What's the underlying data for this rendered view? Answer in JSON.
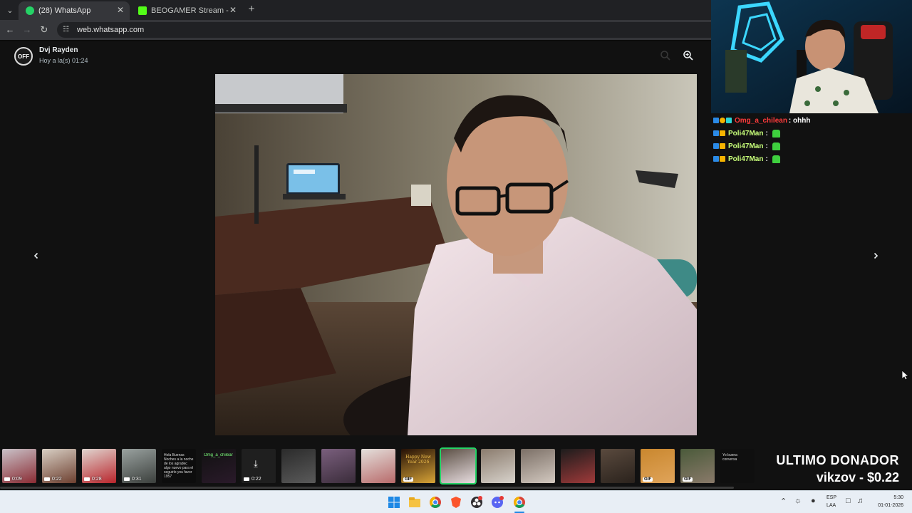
{
  "browser": {
    "tabs": [
      {
        "title": "(28) WhatsApp",
        "favicon": "whatsapp-icon",
        "color": "#25d366",
        "active": true
      },
      {
        "title": "BEOGAMER Stream - Watch Liv",
        "favicon": "kick-icon",
        "color": "#53fc18",
        "active": false
      }
    ],
    "url": "web.whatsapp.com"
  },
  "viewer": {
    "sender_name": "Dvj Rayden",
    "avatar_text": "OFF",
    "sent_time": "Hoy a la(s) 01:24",
    "thumbnails": [
      {
        "kind": "video",
        "duration": "0:09",
        "colors": [
          "#c9c2c8",
          "#8a2b33"
        ]
      },
      {
        "kind": "video",
        "duration": "0:22",
        "colors": [
          "#d8cfc4",
          "#6d3f2f"
        ]
      },
      {
        "kind": "video",
        "duration": "0:28",
        "colors": [
          "#e0d6d0",
          "#b9242b"
        ]
      },
      {
        "kind": "video",
        "duration": "0:31",
        "colors": [
          "#9aa2a0",
          "#3b3f3c"
        ]
      },
      {
        "kind": "text",
        "text": "Hola Buenas Noches a la noche de los agradec algo nuevo para el seguirlo you favor 1957",
        "colors": [
          "#0d0d0d",
          "#0d0d0d"
        ]
      },
      {
        "kind": "text",
        "text": "Omg_a_chilear",
        "colors": [
          "#111",
          "#2a1a2a"
        ]
      },
      {
        "kind": "download",
        "duration": "0:22",
        "colors": [
          "#1f1f1f",
          "#1f1f1f"
        ]
      },
      {
        "kind": "image",
        "colors": [
          "#2b2b2b",
          "#5a5a5a"
        ]
      },
      {
        "kind": "image",
        "colors": [
          "#7a5f7d",
          "#3a2c3a"
        ]
      },
      {
        "kind": "image",
        "colors": [
          "#e4e0dc",
          "#b86a6a"
        ]
      },
      {
        "kind": "gif",
        "caption": "Happy New Year 2026",
        "colors": [
          "#241006",
          "#d8a437"
        ]
      },
      {
        "kind": "selected",
        "colors": [
          "#5b4f44",
          "#e8dde0"
        ]
      },
      {
        "kind": "image",
        "colors": [
          "#8a7b6d",
          "#d8d3cc"
        ]
      },
      {
        "kind": "image",
        "colors": [
          "#7b6f66",
          "#d3c9c0"
        ]
      },
      {
        "kind": "image",
        "colors": [
          "#1c1c1c",
          "#a03a3a"
        ]
      },
      {
        "kind": "image",
        "colors": [
          "#5a4a3e",
          "#2a221c"
        ]
      },
      {
        "kind": "gif",
        "colors": [
          "#c9872e",
          "#e0a45a"
        ]
      },
      {
        "kind": "gif",
        "colors": [
          "#4a5a3a",
          "#8a7a6a"
        ]
      },
      {
        "kind": "text",
        "text": "Yo buena conversa",
        "colors": [
          "#0f0f0f",
          "#0f0f0f"
        ]
      }
    ]
  },
  "chat": {
    "lines": [
      {
        "user": "Omg_a_chilean",
        "user_color": "#ff3b3b",
        "message": ": ohhh",
        "has_emote": false
      },
      {
        "user": "Poli47Man",
        "user_color": "#c8ff7a",
        "message": ":",
        "has_emote": true
      },
      {
        "user": "Poli47Man",
        "user_color": "#c8ff7a",
        "message": ":",
        "has_emote": true
      },
      {
        "user": "Poli47Man",
        "user_color": "#c8ff7a",
        "message": ":",
        "has_emote": true
      }
    ]
  },
  "donor": {
    "title": "ULTIMO DONADOR",
    "name": "vikzov - $0.22"
  },
  "taskbar": {
    "apps": [
      "windows-start-icon",
      "file-explorer-icon",
      "chrome-icon",
      "brave-icon",
      "obs-icon",
      "discord-icon",
      "chrome-active-icon"
    ],
    "lang_top": "ESP",
    "lang_bottom": "LAA",
    "time": "5:30",
    "date": "01-01-2026"
  }
}
